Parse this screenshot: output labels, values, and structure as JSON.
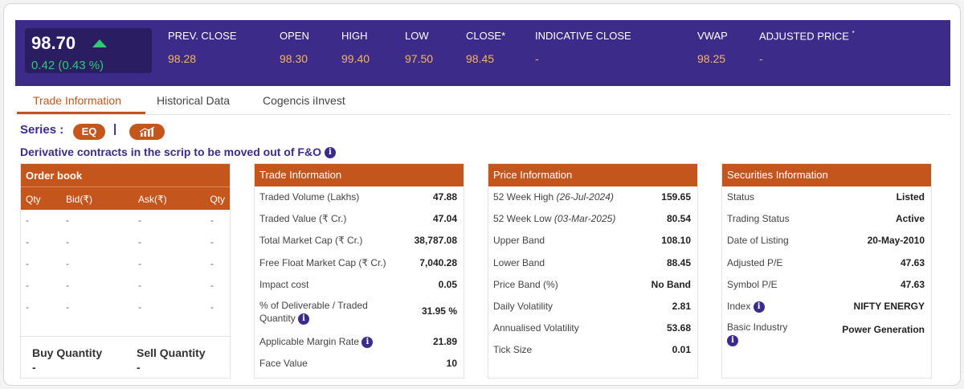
{
  "header": {
    "ltp": "98.70",
    "change": "0.42 (0.43 %)",
    "stats": [
      {
        "label": "PREV. CLOSE",
        "value": "98.28"
      },
      {
        "label": "OPEN",
        "value": "98.30"
      },
      {
        "label": "HIGH",
        "value": "99.40"
      },
      {
        "label": "LOW",
        "value": "97.50"
      },
      {
        "label": "CLOSE*",
        "value": "98.45"
      },
      {
        "label": "INDICATIVE CLOSE",
        "value": "-"
      },
      {
        "label": "VWAP",
        "value": "98.25"
      },
      {
        "label": "ADJUSTED PRICE",
        "value": "-",
        "sup": "*"
      }
    ]
  },
  "tabs": [
    "Trade Information",
    "Historical Data",
    "Cogencis iInvest"
  ],
  "series": {
    "label": "Series :",
    "value": "EQ",
    "separator": "|"
  },
  "notice": "Derivative contracts in the scrip to be moved out of F&O",
  "order_book": {
    "title": "Order book",
    "columns": [
      "Qty",
      "Bid(₹)",
      "Ask(₹)",
      "Qty"
    ],
    "rows": [
      [
        "-",
        "-",
        "-",
        "-"
      ],
      [
        "-",
        "-",
        "-",
        "-"
      ],
      [
        "-",
        "-",
        "-",
        "-"
      ],
      [
        "-",
        "-",
        "-",
        "-"
      ],
      [
        "-",
        "-",
        "-",
        "-"
      ]
    ],
    "buy_label": "Buy Quantity",
    "buy_value": "-",
    "sell_label": "Sell Quantity",
    "sell_value": "-"
  },
  "trade_info": {
    "title": "Trade Information",
    "rows": [
      {
        "k": "Traded Volume (Lakhs)",
        "v": "47.88"
      },
      {
        "k": "Traded Value (₹ Cr.)",
        "v": "47.04"
      },
      {
        "k": "Total Market Cap (₹ Cr.)",
        "v": "38,787.08"
      },
      {
        "k": "Free Float Market Cap (₹ Cr.)",
        "v": "7,040.28"
      },
      {
        "k": "Impact cost",
        "v": "0.05"
      },
      {
        "k": "% of Deliverable / Traded",
        "k2": "Quantity",
        "v": "31.95 %"
      },
      {
        "k": "Applicable Margin Rate",
        "v": "21.89"
      },
      {
        "k": "Face Value",
        "v": "10"
      }
    ]
  },
  "price_info": {
    "title": "Price Information",
    "rows": [
      {
        "k": "52 Week High",
        "d": "(26-Jul-2024)",
        "v": "159.65"
      },
      {
        "k": "52 Week Low",
        "d": "(03-Mar-2025)",
        "v": "80.54"
      },
      {
        "k": "Upper Band",
        "v": "108.10"
      },
      {
        "k": "Lower Band",
        "v": "88.45"
      },
      {
        "k": "Price Band (%)",
        "v": "No Band"
      },
      {
        "k": "Daily Volatility",
        "v": "2.81"
      },
      {
        "k": "Annualised Volatility",
        "v": "53.68"
      },
      {
        "k": "Tick Size",
        "v": "0.01"
      }
    ]
  },
  "securities_info": {
    "title": "Securities Information",
    "rows": [
      {
        "k": "Status",
        "v": "Listed"
      },
      {
        "k": "Trading Status",
        "v": "Active"
      },
      {
        "k": "Date of Listing",
        "v": "20-May-2010"
      },
      {
        "k": "Adjusted P/E",
        "v": "47.63"
      },
      {
        "k": "Symbol P/E",
        "v": "47.63"
      },
      {
        "k": "Index",
        "v": "NIFTY ENERGY"
      },
      {
        "k": "Basic Industry",
        "v": "Power Generation"
      }
    ]
  },
  "icons": {
    "info": "i",
    "chart": "chart-icon"
  },
  "colors": {
    "header_bg": "#3d2b8a",
    "accent": "#c4561d",
    "up": "#2ecc71",
    "value": "#f5b461"
  }
}
